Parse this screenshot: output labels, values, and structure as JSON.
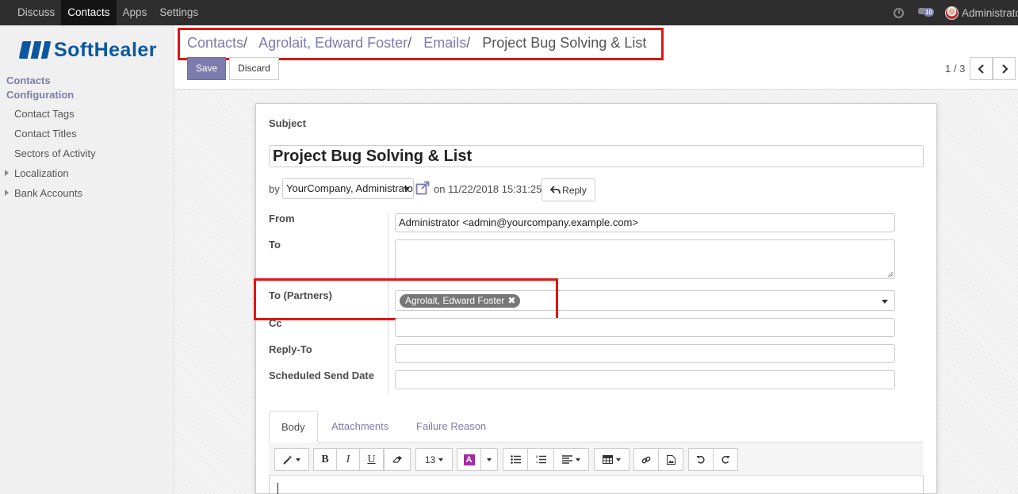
{
  "topbar": {
    "menu": [
      "Discuss",
      "Contacts",
      "Apps",
      "Settings"
    ],
    "active": "Contacts",
    "chat_count": "10",
    "user": "Administrator"
  },
  "sidebar": {
    "logo_text": "SoftHealer",
    "section_contacts": "Contacts",
    "section_config": "Configuration",
    "items": [
      "Contact Tags",
      "Contact Titles",
      "Sectors of Activity",
      "Localization",
      "Bank Accounts"
    ]
  },
  "breadcrumb": {
    "items": [
      "Contacts",
      "Agrolait, Edward Foster",
      "Emails"
    ],
    "current": "Project Bug Solving & List",
    "separator": "/"
  },
  "actions": {
    "save": "Save",
    "discard": "Discard"
  },
  "pager": {
    "text": "1 / 3"
  },
  "form": {
    "subject_label": "Subject",
    "subject_value": "Project Bug Solving & List",
    "by_label": "by",
    "author": "YourCompany, Administrator",
    "on_label": "on",
    "date": "11/22/2018 15:31:25",
    "reply": "Reply",
    "from_label": "From",
    "from_value": "Administrator <admin@yourcompany.example.com>",
    "to_label": "To",
    "to_partners_label": "To (Partners)",
    "partner_tag": "Agrolait, Edward Foster",
    "cc_label": "Cc",
    "reply_to_label": "Reply-To",
    "scheduled_label": "Scheduled Send Date"
  },
  "tabs": [
    "Body",
    "Attachments",
    "Failure Reason"
  ],
  "editor": {
    "font_size": "13"
  },
  "colors": {
    "accent": "#7c7bad",
    "highlight": "#e01414",
    "navbar": "#2e2e2e"
  }
}
